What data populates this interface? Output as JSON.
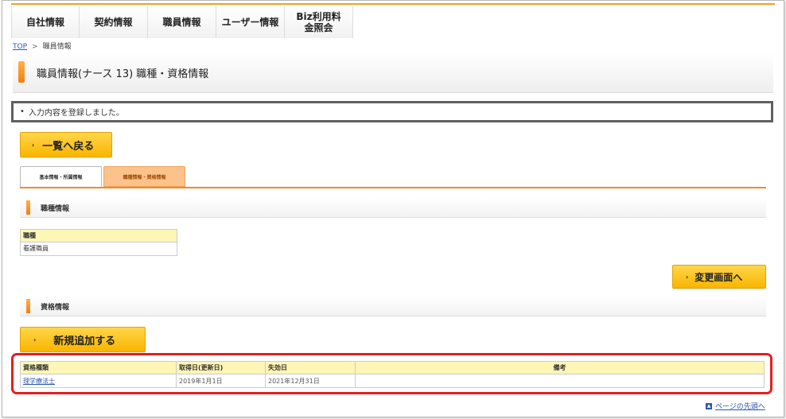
{
  "nav": {
    "items": [
      {
        "label": "自社情報"
      },
      {
        "label": "契約情報"
      },
      {
        "label": "職員情報"
      },
      {
        "label": "ユーザー情報"
      },
      {
        "label": "Biz利用料金照会"
      }
    ]
  },
  "breadcrumb": {
    "top": "TOP",
    "sep": ">",
    "current": "職員情報"
  },
  "page": {
    "title": "職員情報(ナース 13) 職種・資格情報"
  },
  "message": {
    "bullet": "•",
    "text": "入力内容を登録しました。"
  },
  "buttons": {
    "back": "一覧へ戻る",
    "change": "変更画面へ",
    "add": "新規追加する",
    "arrow": "›"
  },
  "tabs": [
    {
      "label": "基本情報・所属情報",
      "active": false
    },
    {
      "label": "職種情報・資格情報",
      "active": true
    }
  ],
  "job_section": {
    "title": "職種情報",
    "header": "職種",
    "value": "看護職員"
  },
  "license_section": {
    "title": "資格情報",
    "columns": [
      "資格種類",
      "取得日(更新日)",
      "失効日",
      "備考"
    ],
    "rows": [
      {
        "type": "理学療法士",
        "acquired": "2019年1月1日",
        "expires": "2021年12月31日",
        "note": ""
      }
    ]
  },
  "footer": {
    "page_top_icon": "▲",
    "page_top": "ページの先頭へ"
  },
  "colors": {
    "accent": "#f08a24",
    "button": "#f9b500",
    "highlight": "#e02020",
    "link": "#2a57b5"
  }
}
